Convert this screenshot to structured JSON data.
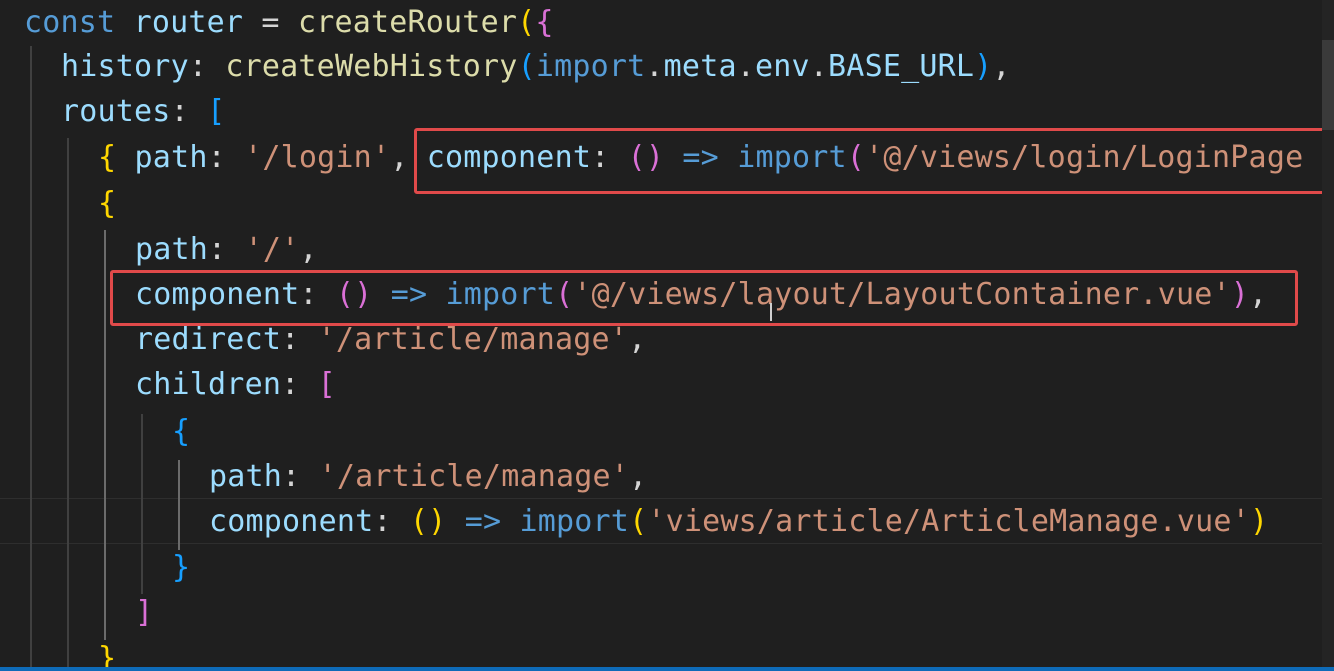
{
  "editor": {
    "lines": [
      {
        "tokens": [
          [
            "kw",
            "const"
          ],
          [
            "pun",
            " "
          ],
          [
            "prop",
            "router"
          ],
          [
            "pun",
            " = "
          ],
          [
            "fn",
            "createRouter"
          ],
          [
            "br1",
            "("
          ],
          [
            "br2",
            "{"
          ]
        ]
      },
      {
        "tokens": [
          [
            "prop",
            "history"
          ],
          [
            "pun",
            ": "
          ],
          [
            "fn",
            "createWebHistory"
          ],
          [
            "br3",
            "("
          ],
          [
            "kw",
            "import"
          ],
          [
            "pun",
            "."
          ],
          [
            "prop",
            "meta"
          ],
          [
            "pun",
            "."
          ],
          [
            "prop",
            "env"
          ],
          [
            "pun",
            "."
          ],
          [
            "prop",
            "BASE_URL"
          ],
          [
            "br3",
            ")"
          ],
          [
            "pun",
            ","
          ]
        ]
      },
      {
        "tokens": [
          [
            "prop",
            "routes"
          ],
          [
            "pun",
            ": "
          ],
          [
            "br3",
            "["
          ]
        ]
      },
      {
        "tokens": [
          [
            "br1",
            "{"
          ],
          [
            "pun",
            " "
          ],
          [
            "prop",
            "path"
          ],
          [
            "pun",
            ": "
          ],
          [
            "str",
            "'/login'"
          ],
          [
            "pun",
            ", "
          ],
          [
            "prop",
            "component"
          ],
          [
            "pun",
            ": "
          ],
          [
            "br2",
            "()"
          ],
          [
            "pun",
            " "
          ],
          [
            "arr",
            "=>"
          ],
          [
            "pun",
            " "
          ],
          [
            "kw",
            "import"
          ],
          [
            "br2",
            "("
          ],
          [
            "str",
            "'@/views/login/LoginPage"
          ]
        ]
      },
      {
        "tokens": [
          [
            "br1",
            "{"
          ]
        ]
      },
      {
        "tokens": [
          [
            "prop",
            "path"
          ],
          [
            "pun",
            ": "
          ],
          [
            "str",
            "'/'"
          ],
          [
            "pun",
            ","
          ]
        ]
      },
      {
        "tokens": [
          [
            "prop",
            "component"
          ],
          [
            "pun",
            ": "
          ],
          [
            "br2",
            "()"
          ],
          [
            "pun",
            " "
          ],
          [
            "arr",
            "=>"
          ],
          [
            "pun",
            " "
          ],
          [
            "kw",
            "import"
          ],
          [
            "br2",
            "("
          ],
          [
            "str",
            "'@/views/layout/LayoutContainer.vue'"
          ],
          [
            "br2",
            ")"
          ],
          [
            "pun",
            ","
          ]
        ]
      },
      {
        "tokens": [
          [
            "prop",
            "redirect"
          ],
          [
            "pun",
            ": "
          ],
          [
            "str",
            "'/article/manage'"
          ],
          [
            "pun",
            ","
          ]
        ]
      },
      {
        "tokens": [
          [
            "prop",
            "children"
          ],
          [
            "pun",
            ": "
          ],
          [
            "br2",
            "["
          ]
        ]
      },
      {
        "tokens": [
          [
            "br3",
            "{"
          ]
        ]
      },
      {
        "tokens": [
          [
            "prop",
            "path"
          ],
          [
            "pun",
            ": "
          ],
          [
            "str",
            "'/article/manage'"
          ],
          [
            "pun",
            ","
          ]
        ]
      },
      {
        "tokens": [
          [
            "prop",
            "component"
          ],
          [
            "pun",
            ": "
          ],
          [
            "br1",
            "()"
          ],
          [
            "pun",
            " "
          ],
          [
            "arr",
            "=>"
          ],
          [
            "pun",
            " "
          ],
          [
            "kw",
            "import"
          ],
          [
            "br1",
            "("
          ],
          [
            "str",
            "'views/article/ArticleManage.vue'"
          ],
          [
            "br1",
            ")"
          ]
        ]
      },
      {
        "tokens": [
          [
            "br3",
            "}"
          ]
        ]
      },
      {
        "tokens": [
          [
            "br2",
            "]"
          ]
        ]
      },
      {
        "tokens": [
          [
            "br1",
            "}"
          ]
        ]
      }
    ]
  },
  "colors": {
    "background": "#1f1f1f",
    "highlight_box": "#e04a4a",
    "statusbar": "#0e6bb8"
  }
}
